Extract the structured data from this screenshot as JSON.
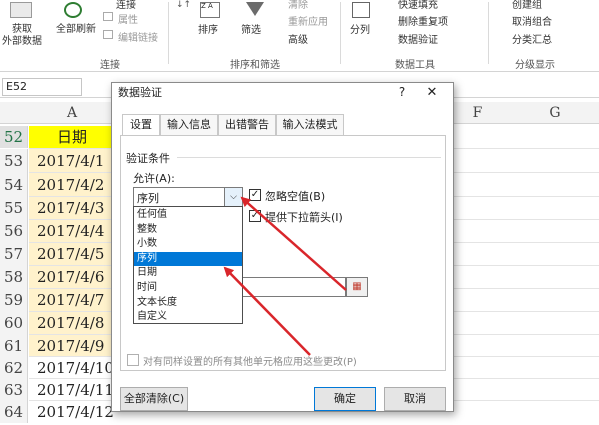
{
  "ribbon": {
    "groups": [
      {
        "label": "连接"
      },
      {
        "label": "排序和筛选"
      },
      {
        "label": "数据工具"
      },
      {
        "label": "分级显示"
      }
    ],
    "get_data_line1": "获取",
    "get_data_line2": "外部数据",
    "refresh_all_line1": "全部刷新",
    "connections": "连接",
    "properties": "属性",
    "edit_links": "编辑链接",
    "sort": "排序",
    "filter": "筛选",
    "clear": "清除",
    "reapply": "重新应用",
    "advanced": "高级",
    "split": "分列",
    "flash_fill": "快速填充",
    "remove_duplicates": "删除重复项",
    "data_validation": "数据验证",
    "create_group": "创建组",
    "ungroup": "取消组合",
    "subtotal": "分类汇总"
  },
  "namebox": {
    "value": "E52"
  },
  "columns": [
    "A",
    "F",
    "G"
  ],
  "rows": [
    {
      "num": "52",
      "value": "日期"
    },
    {
      "num": "53",
      "value": "2017/4/1"
    },
    {
      "num": "54",
      "value": "2017/4/2"
    },
    {
      "num": "55",
      "value": "2017/4/3"
    },
    {
      "num": "56",
      "value": "2017/4/4"
    },
    {
      "num": "57",
      "value": "2017/4/5"
    },
    {
      "num": "58",
      "value": "2017/4/6"
    },
    {
      "num": "59",
      "value": "2017/4/7"
    },
    {
      "num": "60",
      "value": "2017/4/8"
    },
    {
      "num": "61",
      "value": "2017/4/9"
    },
    {
      "num": "62",
      "value": "2017/4/10"
    },
    {
      "num": "63",
      "value": "2017/4/11"
    },
    {
      "num": "64",
      "value": "2017/4/12"
    }
  ],
  "dialog": {
    "title": "数据验证",
    "help": "?",
    "close": "✕",
    "tabs": [
      "设置",
      "输入信息",
      "出错警告",
      "输入法模式"
    ],
    "section_title": "验证条件",
    "allow_label": "允许(A):",
    "allow_value": "序列",
    "ignore_blank": "忽略空值(B)",
    "dropdown_arrow": "提供下拉箭头(I)",
    "apply_all": "对有同样设置的所有其他单元格应用这些更改(P)",
    "clear_all": "全部清除(C)",
    "ok": "确定",
    "cancel": "取消",
    "options": [
      "任何值",
      "整数",
      "小数",
      "序列",
      "日期",
      "时间",
      "文本长度",
      "自定义"
    ],
    "selected_option": "序列"
  },
  "colors": {
    "header_fill": "#ffff00",
    "date_fill": "#fff2cc",
    "selected_tab": "#217346",
    "arrow": "#d9262b",
    "selection": "#0078d7"
  }
}
